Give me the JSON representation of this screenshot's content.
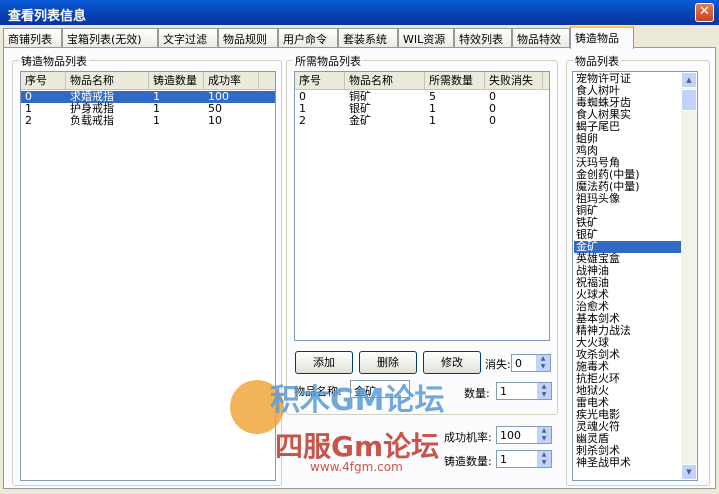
{
  "window": {
    "title": "查看列表信息",
    "close": "✕"
  },
  "tabs": [
    "商铺列表",
    "宝箱列表(无效)",
    "文字过滤",
    "物品规则",
    "用户命令",
    "套装系统",
    "WIL资源",
    "特效列表",
    "物品特效",
    "铸造物品"
  ],
  "active_tab": "铸造物品",
  "cast_group": {
    "label": "铸造物品列表",
    "columns": [
      "序号",
      "物品名称",
      "铸造数量",
      "成功率"
    ],
    "rows": [
      [
        "0",
        "求婚戒指",
        "1",
        "100"
      ],
      [
        "1",
        "护身戒指",
        "1",
        "50"
      ],
      [
        "2",
        "负载戒指",
        "1",
        "10"
      ]
    ],
    "selected_row": 0
  },
  "required_group": {
    "label": "所需物品列表",
    "columns": [
      "序号",
      "物品名称",
      "所需数量",
      "失败消失"
    ],
    "rows": [
      [
        "0",
        "铜矿",
        "5",
        "0"
      ],
      [
        "1",
        "银矿",
        "1",
        "0"
      ],
      [
        "2",
        "金矿",
        "1",
        "0"
      ]
    ],
    "buttons": {
      "add": "添加",
      "delete": "删除",
      "edit": "修改"
    },
    "lose_label": "消失:",
    "lose_value": "0"
  },
  "edit_form": {
    "item_name_label": "物品名称:",
    "item_name_value": "金矿",
    "qty_label": "数量:",
    "qty_value": "1",
    "chance_label": "成功机率:",
    "chance_value": "100",
    "cast_qty_label": "铸造数量:",
    "cast_qty_value": "1"
  },
  "item_list": {
    "label": "物品列表",
    "items": [
      "宠物许可证",
      "食人树叶",
      "毒蜘蛛牙齿",
      "食人树果实",
      "蝎子尾巴",
      "蛆卵",
      "鸡肉",
      "沃玛号角",
      "金创药(中量)",
      "魔法药(中量)",
      "祖玛头像",
      "铜矿",
      "铁矿",
      "银矿",
      "金矿",
      "英雄宝盒",
      "战神油",
      "祝福油",
      "火球术",
      "治愈术",
      "基本剑术",
      "精神力战法",
      "大火球",
      "攻杀剑术",
      "施毒术",
      "抗拒火环",
      "地狱火",
      "雷电术",
      "疾光电影",
      "灵魂火符",
      "幽灵盾",
      "刺杀剑术",
      "神圣战甲术"
    ],
    "selected_index": 14
  },
  "watermark": {
    "line1": "积木GM论坛",
    "line2": "四服Gm论坛",
    "line3": "www.4fgm.com"
  }
}
